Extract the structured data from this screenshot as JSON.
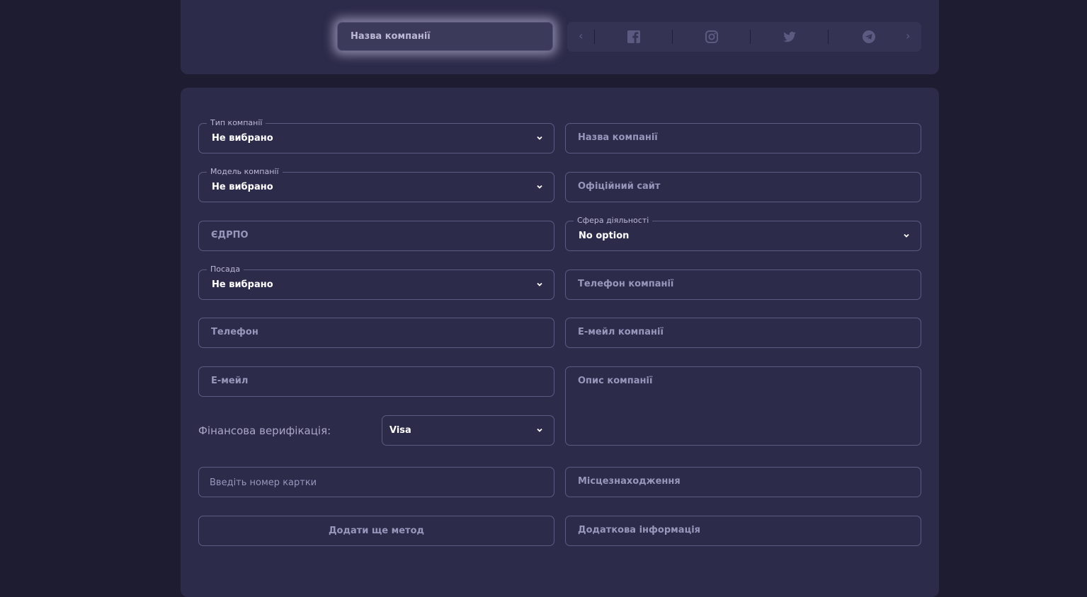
{
  "header": {
    "company_name_placeholder": "Назва компанії",
    "social_icons": [
      "facebook-icon",
      "instagram-icon",
      "twitter-icon",
      "telegram-icon"
    ]
  },
  "form": {
    "company_type": {
      "label": "Тип компанії",
      "value": "Не вибрано"
    },
    "company_name": {
      "placeholder": "Назва компанії"
    },
    "company_model": {
      "label": "Модель компанії",
      "value": "Не вибрано"
    },
    "official_site": {
      "placeholder": "Офіційний сайт"
    },
    "edrpou": {
      "placeholder": "ЄДРПО"
    },
    "activity_sphere": {
      "label": "Сфера діяльності",
      "value": "No option"
    },
    "position": {
      "label": "Посада",
      "value": "Не вибрано"
    },
    "company_phone": {
      "placeholder": "Телефон компанії"
    },
    "phone": {
      "placeholder": "Телефон"
    },
    "company_email": {
      "placeholder": "Е-мейл компанії"
    },
    "email": {
      "placeholder": "Е-мейл"
    },
    "company_description": {
      "placeholder": "Опис компанії"
    },
    "financial_verification": {
      "label": "Фінансова верифікація:",
      "value": "Visa"
    },
    "card_number": {
      "placeholder": "Введіть номер картки"
    },
    "location": {
      "placeholder": "Місцезнаходження"
    },
    "add_method_label": "Додати ще метод",
    "additional_info": {
      "placeholder": "Додаткова інформація"
    }
  },
  "colors": {
    "background": "#1d1c31",
    "panel": "#2d2b4a",
    "border": "#5e5b83",
    "placeholder": "#9896bb"
  }
}
